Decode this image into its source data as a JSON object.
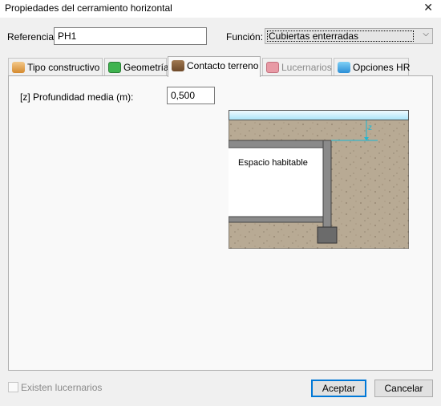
{
  "window": {
    "title": "Propiedades del cerramiento horizontal",
    "close_glyph": "✕"
  },
  "referencia": {
    "label": "Referencia:",
    "value": "PH1"
  },
  "funcion": {
    "label": "Función:",
    "selected": "Cubiertas enterradas",
    "arrow_glyph": "⌵"
  },
  "tabs": [
    {
      "label": "Tipo constructivo",
      "icon": "tipo-constructivo-icon",
      "state": "normal"
    },
    {
      "label": "Geometría",
      "icon": "geometria-icon",
      "state": "normal"
    },
    {
      "label": "Contacto terreno",
      "icon": "contacto-terreno-icon",
      "state": "active"
    },
    {
      "label": "Lucernarios",
      "icon": "lucernarios-icon",
      "state": "disabled"
    },
    {
      "label": "Opciones HR",
      "icon": "opciones-hr-icon",
      "state": "normal"
    }
  ],
  "profundidad": {
    "label": "[z] Profundidad media (m):",
    "value": "0,500"
  },
  "diagram": {
    "space_label": "Espacio habitable",
    "z_label": "z"
  },
  "footer": {
    "checkbox_label": "Existen lucernarios",
    "accept_label": "Aceptar",
    "cancel_label": "Cancelar"
  },
  "colors": {
    "soil": "#b8aa94",
    "water": "#cfeefa",
    "wall": "#6b6b6b",
    "accent_blue": "#0078d7",
    "cyan_dimension": "#19b8d6"
  }
}
